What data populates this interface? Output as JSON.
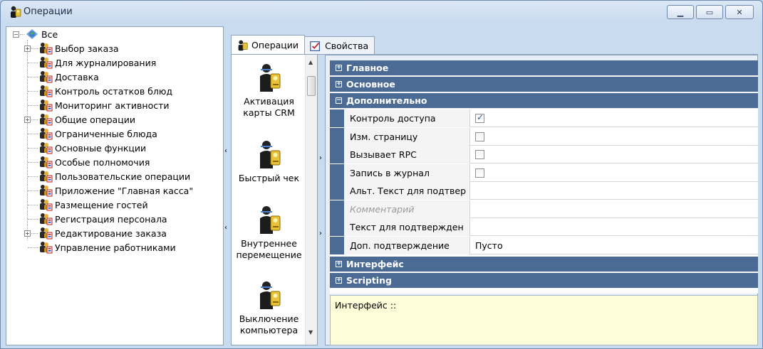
{
  "window": {
    "title": "Операции",
    "minimize": "▁",
    "maximize": "▭",
    "close": "✕"
  },
  "tree": {
    "root": "Все",
    "items": [
      {
        "label": "Выбор заказа",
        "expandable": true
      },
      {
        "label": "Для журналирования",
        "expandable": false
      },
      {
        "label": "Доставка",
        "expandable": false
      },
      {
        "label": "Контроль остатков блюд",
        "expandable": false
      },
      {
        "label": "Мониторинг активности",
        "expandable": false
      },
      {
        "label": "Общие операции",
        "expandable": true
      },
      {
        "label": "Ограниченные блюда",
        "expandable": false
      },
      {
        "label": "Основные функции",
        "expandable": false
      },
      {
        "label": "Особые полномочия",
        "expandable": false
      },
      {
        "label": "Пользовательские операции",
        "expandable": false
      },
      {
        "label": "Приложение \"Главная касса\"",
        "expandable": false
      },
      {
        "label": "Размещение гостей",
        "expandable": false
      },
      {
        "label": "Регистрация персонала",
        "expandable": false
      },
      {
        "label": "Редактирование заказа",
        "expandable": true
      },
      {
        "label": "Управление работниками",
        "expandable": false
      }
    ]
  },
  "tabs": [
    {
      "label": "Операции",
      "active": true
    },
    {
      "label": "Свойства",
      "active": false
    }
  ],
  "operations": [
    {
      "line1": "Активация",
      "line2": "карты CRM"
    },
    {
      "line1": "Быстрый чек",
      "line2": ""
    },
    {
      "line1": "Внутреннее",
      "line2": "перемещение"
    },
    {
      "line1": "Выключение",
      "line2": "компьютера"
    }
  ],
  "grid": {
    "categories": {
      "main": "Главное",
      "basic": "Основное",
      "extra": "Дополнительно",
      "interface": "Интерфейс",
      "scripting": "Scripting"
    },
    "props": [
      {
        "name": "Контроль доступа",
        "type": "checkbox",
        "checked": true
      },
      {
        "name": "Изм. страницу",
        "type": "checkbox",
        "checked": false
      },
      {
        "name": "Вызывает RPC",
        "type": "checkbox",
        "checked": false
      },
      {
        "name": "Запись в журнал",
        "type": "checkbox",
        "checked": false
      },
      {
        "name": "Альт. Текст для подтвер",
        "type": "text",
        "value": ""
      },
      {
        "name": "Комментарий",
        "type": "text",
        "value": "",
        "disabled": true
      },
      {
        "name": "Текст для подтвержден",
        "type": "text",
        "value": ""
      },
      {
        "name": "Доп. подтверждение",
        "type": "text",
        "value": "Пусто"
      }
    ],
    "expand_minus": "−",
    "expand_plus": "+"
  },
  "description": "Интерфейс ::",
  "colors": {
    "category_bg": "#4b6b95",
    "desc_bg": "#fefdd9"
  }
}
